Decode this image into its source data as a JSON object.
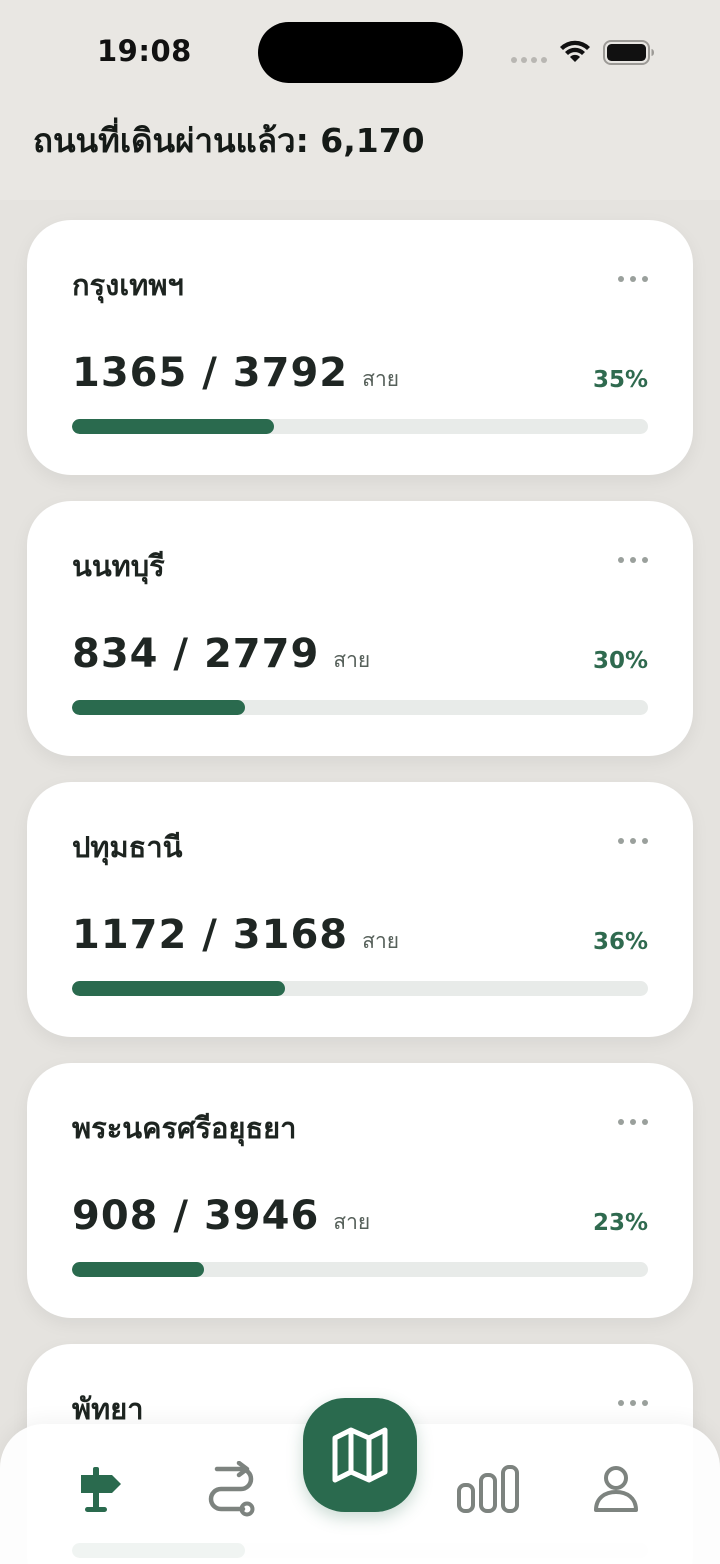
{
  "status_bar": {
    "time": "19:08"
  },
  "header": {
    "title": "ถนนที่เดินผ่านแล้ว: 6,170"
  },
  "cards": [
    {
      "name": "กรุงเทพฯ",
      "count": "1365 / 3792",
      "unit": "สาย",
      "percent_label": "35%",
      "progress": 0.35
    },
    {
      "name": "นนทบุรี",
      "count": "834 / 2779",
      "unit": "สาย",
      "percent_label": "30%",
      "progress": 0.3
    },
    {
      "name": "ปทุมธานี",
      "count": "1172 / 3168",
      "unit": "สาย",
      "percent_label": "36%",
      "progress": 0.37
    },
    {
      "name": "พระนครศรีอยุธยา",
      "count": "908 / 3946",
      "unit": "สาย",
      "percent_label": "23%",
      "progress": 0.23
    },
    {
      "name": "พัทยา",
      "count": "",
      "unit": "",
      "percent_label": "",
      "progress": 0.3
    }
  ],
  "tabbar": {
    "active_color": "#2a6a4e",
    "inactive_color": "#7d837f",
    "items": [
      "signpost-icon",
      "route-icon",
      "map-icon",
      "bar-chart-icon",
      "person-icon"
    ]
  }
}
